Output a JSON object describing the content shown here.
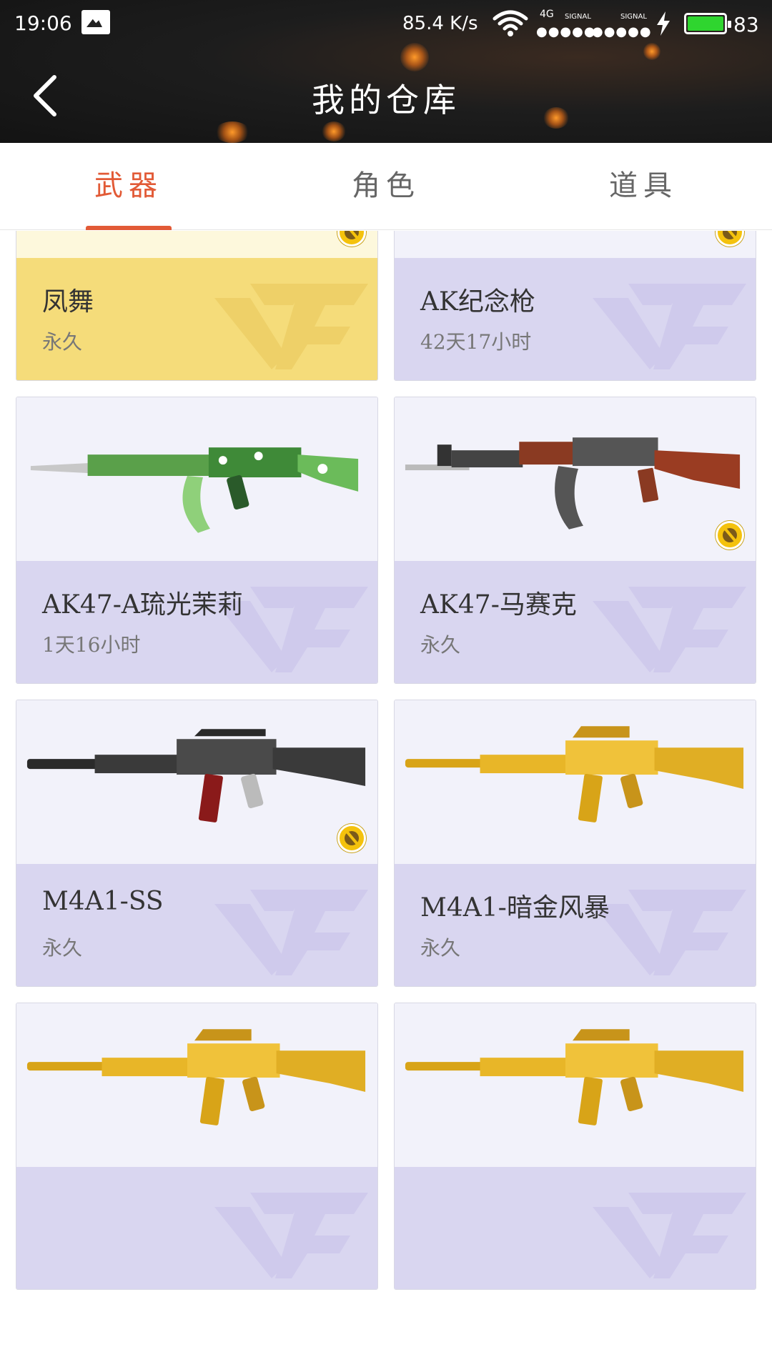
{
  "status_bar": {
    "time": "19:06",
    "net_speed": "85.4 K/s",
    "net_type": "4G",
    "signal_label": "SIGNAL",
    "signal_label_2": "SIGNAL",
    "battery_level": "83"
  },
  "header": {
    "title": "我的仓库",
    "back_icon": "chevron-left-icon"
  },
  "tabs": [
    {
      "label": "武器",
      "active": true
    },
    {
      "label": "角色",
      "active": false
    },
    {
      "label": "道具",
      "active": false
    }
  ],
  "weapons": [
    {
      "name": "凤舞",
      "duration": "永久",
      "style": "gold",
      "badge": true,
      "art": "knife"
    },
    {
      "name": "AK纪念枪",
      "duration": "42天17小时",
      "style": "purple",
      "badge": true,
      "art": "ak-blue"
    },
    {
      "name": "AK47-A琉光茉莉",
      "duration": "1天16小时",
      "style": "purple",
      "badge": false,
      "art": "ak-green"
    },
    {
      "name": "AK47-马赛克",
      "duration": "永久",
      "style": "purple",
      "badge": true,
      "art": "ak-pixel"
    },
    {
      "name": "M4A1-SS",
      "duration": "永久",
      "style": "purple",
      "badge": true,
      "art": "m4-black"
    },
    {
      "name": "M4A1-暗金风暴",
      "duration": "永久",
      "style": "purple",
      "badge": false,
      "art": "m4-gold"
    },
    {
      "name": "",
      "duration": "",
      "style": "purple",
      "badge": false,
      "art": "m4-gold"
    },
    {
      "name": "",
      "duration": "",
      "style": "purple",
      "badge": false,
      "art": "m4-gold"
    }
  ],
  "colors": {
    "accent": "#e25a36",
    "gold_card": "#f5dc7a",
    "purple_card": "#d9d6f0",
    "battery": "#2fd52f"
  }
}
